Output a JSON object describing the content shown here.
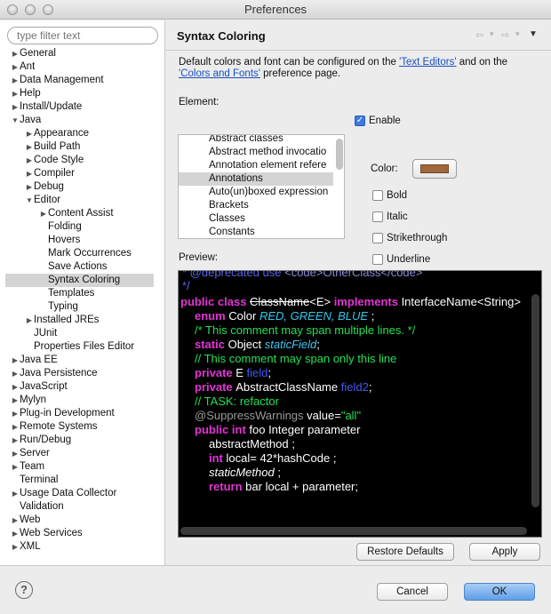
{
  "window": {
    "title": "Preferences"
  },
  "filter": {
    "placeholder": "type filter text"
  },
  "tree": [
    {
      "label": "General",
      "indent": 0,
      "arrow": "▶",
      "selected": false
    },
    {
      "label": "Ant",
      "indent": 0,
      "arrow": "▶",
      "selected": false
    },
    {
      "label": "Data Management",
      "indent": 0,
      "arrow": "▶",
      "selected": false
    },
    {
      "label": "Help",
      "indent": 0,
      "arrow": "▶",
      "selected": false
    },
    {
      "label": "Install/Update",
      "indent": 0,
      "arrow": "▶",
      "selected": false
    },
    {
      "label": "Java",
      "indent": 0,
      "arrow": "▼",
      "selected": false
    },
    {
      "label": "Appearance",
      "indent": 1,
      "arrow": "▶",
      "selected": false
    },
    {
      "label": "Build Path",
      "indent": 1,
      "arrow": "▶",
      "selected": false
    },
    {
      "label": "Code Style",
      "indent": 1,
      "arrow": "▶",
      "selected": false
    },
    {
      "label": "Compiler",
      "indent": 1,
      "arrow": "▶",
      "selected": false
    },
    {
      "label": "Debug",
      "indent": 1,
      "arrow": "▶",
      "selected": false
    },
    {
      "label": "Editor",
      "indent": 1,
      "arrow": "▼",
      "selected": false
    },
    {
      "label": "Content Assist",
      "indent": 2,
      "arrow": "▶",
      "selected": false
    },
    {
      "label": "Folding",
      "indent": 2,
      "arrow": "",
      "selected": false
    },
    {
      "label": "Hovers",
      "indent": 2,
      "arrow": "",
      "selected": false
    },
    {
      "label": "Mark Occurrences",
      "indent": 2,
      "arrow": "",
      "selected": false
    },
    {
      "label": "Save Actions",
      "indent": 2,
      "arrow": "",
      "selected": false
    },
    {
      "label": "Syntax Coloring",
      "indent": 2,
      "arrow": "",
      "selected": true
    },
    {
      "label": "Templates",
      "indent": 2,
      "arrow": "",
      "selected": false
    },
    {
      "label": "Typing",
      "indent": 2,
      "arrow": "",
      "selected": false
    },
    {
      "label": "Installed JREs",
      "indent": 1,
      "arrow": "▶",
      "selected": false
    },
    {
      "label": "JUnit",
      "indent": 1,
      "arrow": "",
      "selected": false
    },
    {
      "label": "Properties Files Editor",
      "indent": 1,
      "arrow": "",
      "selected": false
    },
    {
      "label": "Java EE",
      "indent": 0,
      "arrow": "▶",
      "selected": false
    },
    {
      "label": "Java Persistence",
      "indent": 0,
      "arrow": "▶",
      "selected": false
    },
    {
      "label": "JavaScript",
      "indent": 0,
      "arrow": "▶",
      "selected": false
    },
    {
      "label": "Mylyn",
      "indent": 0,
      "arrow": "▶",
      "selected": false
    },
    {
      "label": "Plug-in Development",
      "indent": 0,
      "arrow": "▶",
      "selected": false
    },
    {
      "label": "Remote Systems",
      "indent": 0,
      "arrow": "▶",
      "selected": false
    },
    {
      "label": "Run/Debug",
      "indent": 0,
      "arrow": "▶",
      "selected": false
    },
    {
      "label": "Server",
      "indent": 0,
      "arrow": "▶",
      "selected": false
    },
    {
      "label": "Team",
      "indent": 0,
      "arrow": "▶",
      "selected": false
    },
    {
      "label": "Terminal",
      "indent": 0,
      "arrow": "",
      "selected": false
    },
    {
      "label": "Usage Data Collector",
      "indent": 0,
      "arrow": "▶",
      "selected": false
    },
    {
      "label": "Validation",
      "indent": 0,
      "arrow": "",
      "selected": false
    },
    {
      "label": "Web",
      "indent": 0,
      "arrow": "▶",
      "selected": false
    },
    {
      "label": "Web Services",
      "indent": 0,
      "arrow": "▶",
      "selected": false
    },
    {
      "label": "XML",
      "indent": 0,
      "arrow": "▶",
      "selected": false
    }
  ],
  "page": {
    "title": "Syntax Coloring",
    "nav": {
      "back": "⇦",
      "back_menu": "▾",
      "forward": "⇨",
      "forward_menu": "▾",
      "menu": "▼"
    },
    "desc_before": "Default colors and font can be configured on the ",
    "link1": "'Text Editors'",
    "desc_middle": " and on the ",
    "link2": "'Colors and Fonts'",
    "desc_after": " preference page.",
    "element_label": "Element:",
    "elements": [
      "Abstract classes",
      "Abstract method invocatio",
      "Annotation element refere",
      "Annotations",
      "Auto(un)boxed expression",
      "Brackets",
      "Classes",
      "Constants"
    ],
    "selected_element_index": 3,
    "enable_label": "Enable",
    "color_label": "Color:",
    "color_value": "#a0683c",
    "bold_label": "Bold",
    "italic_label": "Italic",
    "strike_label": "Strikethrough",
    "underline_label": "Underline",
    "preview_label": "Preview:",
    "restore_defaults": "Restore Defaults",
    "apply": "Apply"
  },
  "preview": {
    "line0": {
      "a": "* @deprecated use ",
      "b": "<code>OtherClass</code>"
    },
    "line1": {
      "a": "*/"
    },
    "line2": {
      "kw1": "public class ",
      "cls": "ClassName",
      "gen": "<E> ",
      "kw2": "implements ",
      "rest": "InterfaceName<String>"
    },
    "line3": {
      "kw": "enum ",
      "name": "Color   ",
      "vals": "RED, GREEN, BLUE",
      "end": " ;"
    },
    "line4": {
      "cm": "/* This comment may span multiple lines. */"
    },
    "line5": {
      "kw": "static ",
      "type": "Object ",
      "fld": "staticField",
      "end": ";"
    },
    "line6": {
      "cm": "// This comment may span only this line"
    },
    "line7": {
      "kw": "private ",
      "type": "E ",
      "fld": "field",
      "end": ";"
    },
    "line8": {
      "kw": "private ",
      "type": "AbstractClassName ",
      "fld": "field2",
      "end": ";"
    },
    "line9": {
      "cm": "// ",
      "task": "TASK",
      "rest": ": refactor"
    },
    "line10": {
      "ann": "@SuppressWarnings ",
      "attr": "value=",
      "str": "\"all\""
    },
    "line11": {
      "kw": "public int ",
      "rest": "foo Integer parameter"
    },
    "line12": {
      "rest": "abstractMethod   ;"
    },
    "line13": {
      "kw": "int ",
      "rest": "local= 42*hashCode    ;"
    },
    "line14": {
      "ital": "staticMethod",
      "rest": "   ;"
    },
    "line15": {
      "kw": "return ",
      "rest": "bar local   + parameter;"
    }
  },
  "buttons": {
    "help": "?",
    "cancel": "Cancel",
    "ok": "OK"
  }
}
